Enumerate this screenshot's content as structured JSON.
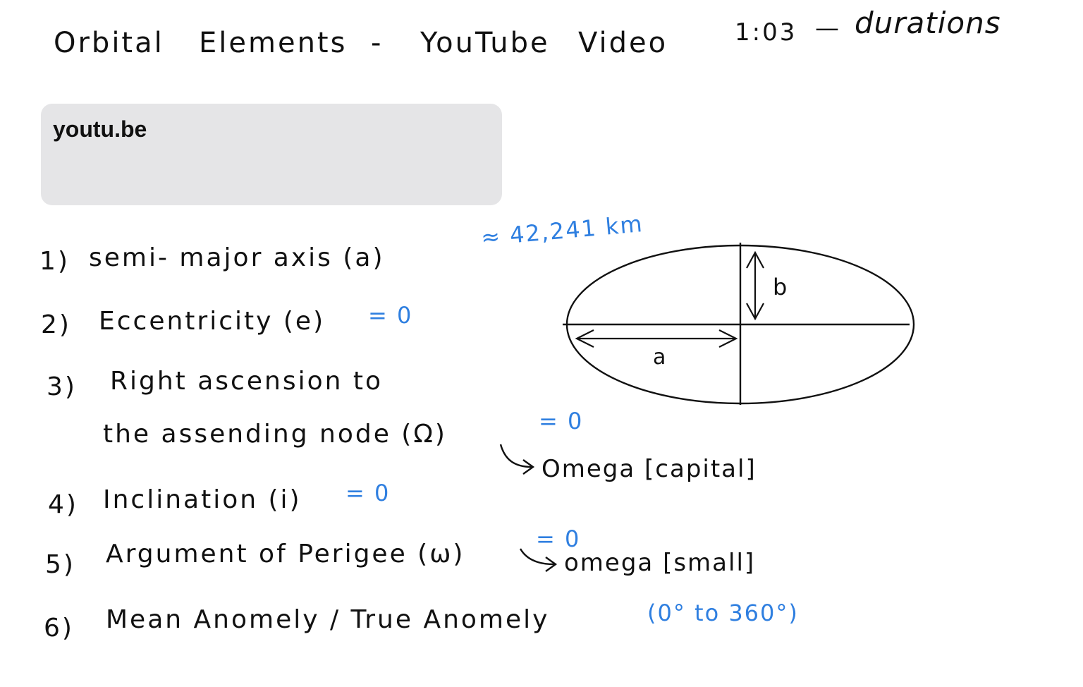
{
  "header": {
    "title_part1": "Orbital",
    "title_part2": "Elements",
    "dash": "-",
    "title_part3": "YouTube",
    "title_part4": "Video",
    "duration_value": "1:03",
    "duration_sep": "—",
    "duration_label": "durations"
  },
  "link_card": {
    "url_text": "youtu.be"
  },
  "elements": [
    {
      "num": "1)",
      "text": "semi- major  axis (a)",
      "value": "≈ 42,241  km"
    },
    {
      "num": "2)",
      "text": "Eccentricity (e)",
      "value": "= 0"
    },
    {
      "num": "3)",
      "text": "Right  ascension  to",
      "text2": "the  assending  node (Ω)",
      "value": "= 0",
      "note": "Omega  [capital]"
    },
    {
      "num": "4)",
      "text": "Inclination (i)",
      "value": "= 0"
    },
    {
      "num": "5)",
      "text": "Argument  of  Perigee (ω)",
      "value": "= 0",
      "note": "omega  [small]"
    },
    {
      "num": "6)",
      "text": "Mean  Anomely / True  Anomely",
      "value": "(0° to  360°)"
    }
  ],
  "diagram": {
    "label_a": "a",
    "label_b": "b",
    "stroke_color": "#111111"
  },
  "colors": {
    "ink": "#111111",
    "accent_blue": "#2f7fe0",
    "card_bg": "#e5e5e7"
  }
}
